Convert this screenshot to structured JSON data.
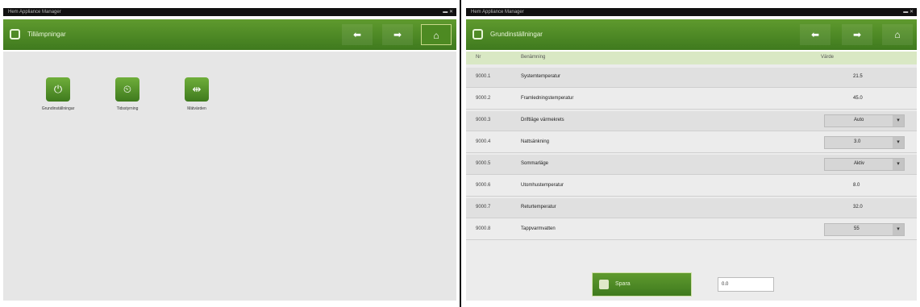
{
  "left": {
    "window_title": "Hem Appliance Manager",
    "header_title": "Tillämpningar",
    "nav": {
      "back": "⬅",
      "forward": "➡",
      "home": "⌂"
    },
    "tiles": [
      {
        "icon": "⏻",
        "label": "Grundinställningar"
      },
      {
        "icon": "⏲",
        "label": "Tidsstyrning"
      },
      {
        "icon": "⇹",
        "label": "Mätvärden"
      }
    ]
  },
  "right": {
    "window_title": "Hem Appliance Manager",
    "header_title": "Grundinställningar",
    "columns": {
      "code": "Nr",
      "name": "Benämning",
      "value": "Värde"
    },
    "rows": [
      {
        "code": "9000.1",
        "desc": "Systemtemperatur",
        "value": "21.5",
        "control": false
      },
      {
        "code": "9000.2",
        "desc": "Framledningstemperatur",
        "value": "45.0",
        "control": false
      },
      {
        "code": "9000.3",
        "desc": "Driftläge värmekrets",
        "value": "Auto",
        "control": true
      },
      {
        "code": "9000.4",
        "desc": "Nattsänkning",
        "value": "3.0",
        "control": true
      },
      {
        "code": "9000.5",
        "desc": "Sommarläge",
        "value": "Aktiv",
        "control": true
      },
      {
        "code": "9000.6",
        "desc": "Utomhustemperatur",
        "value": "8.0",
        "control": false
      },
      {
        "code": "9000.7",
        "desc": "Returtemperatur",
        "value": "32.0",
        "control": false
      },
      {
        "code": "9000.8",
        "desc": "Tappvarmvatten",
        "value": "55",
        "control": true
      }
    ],
    "save_label": "Spara",
    "field_value": "0.0"
  }
}
